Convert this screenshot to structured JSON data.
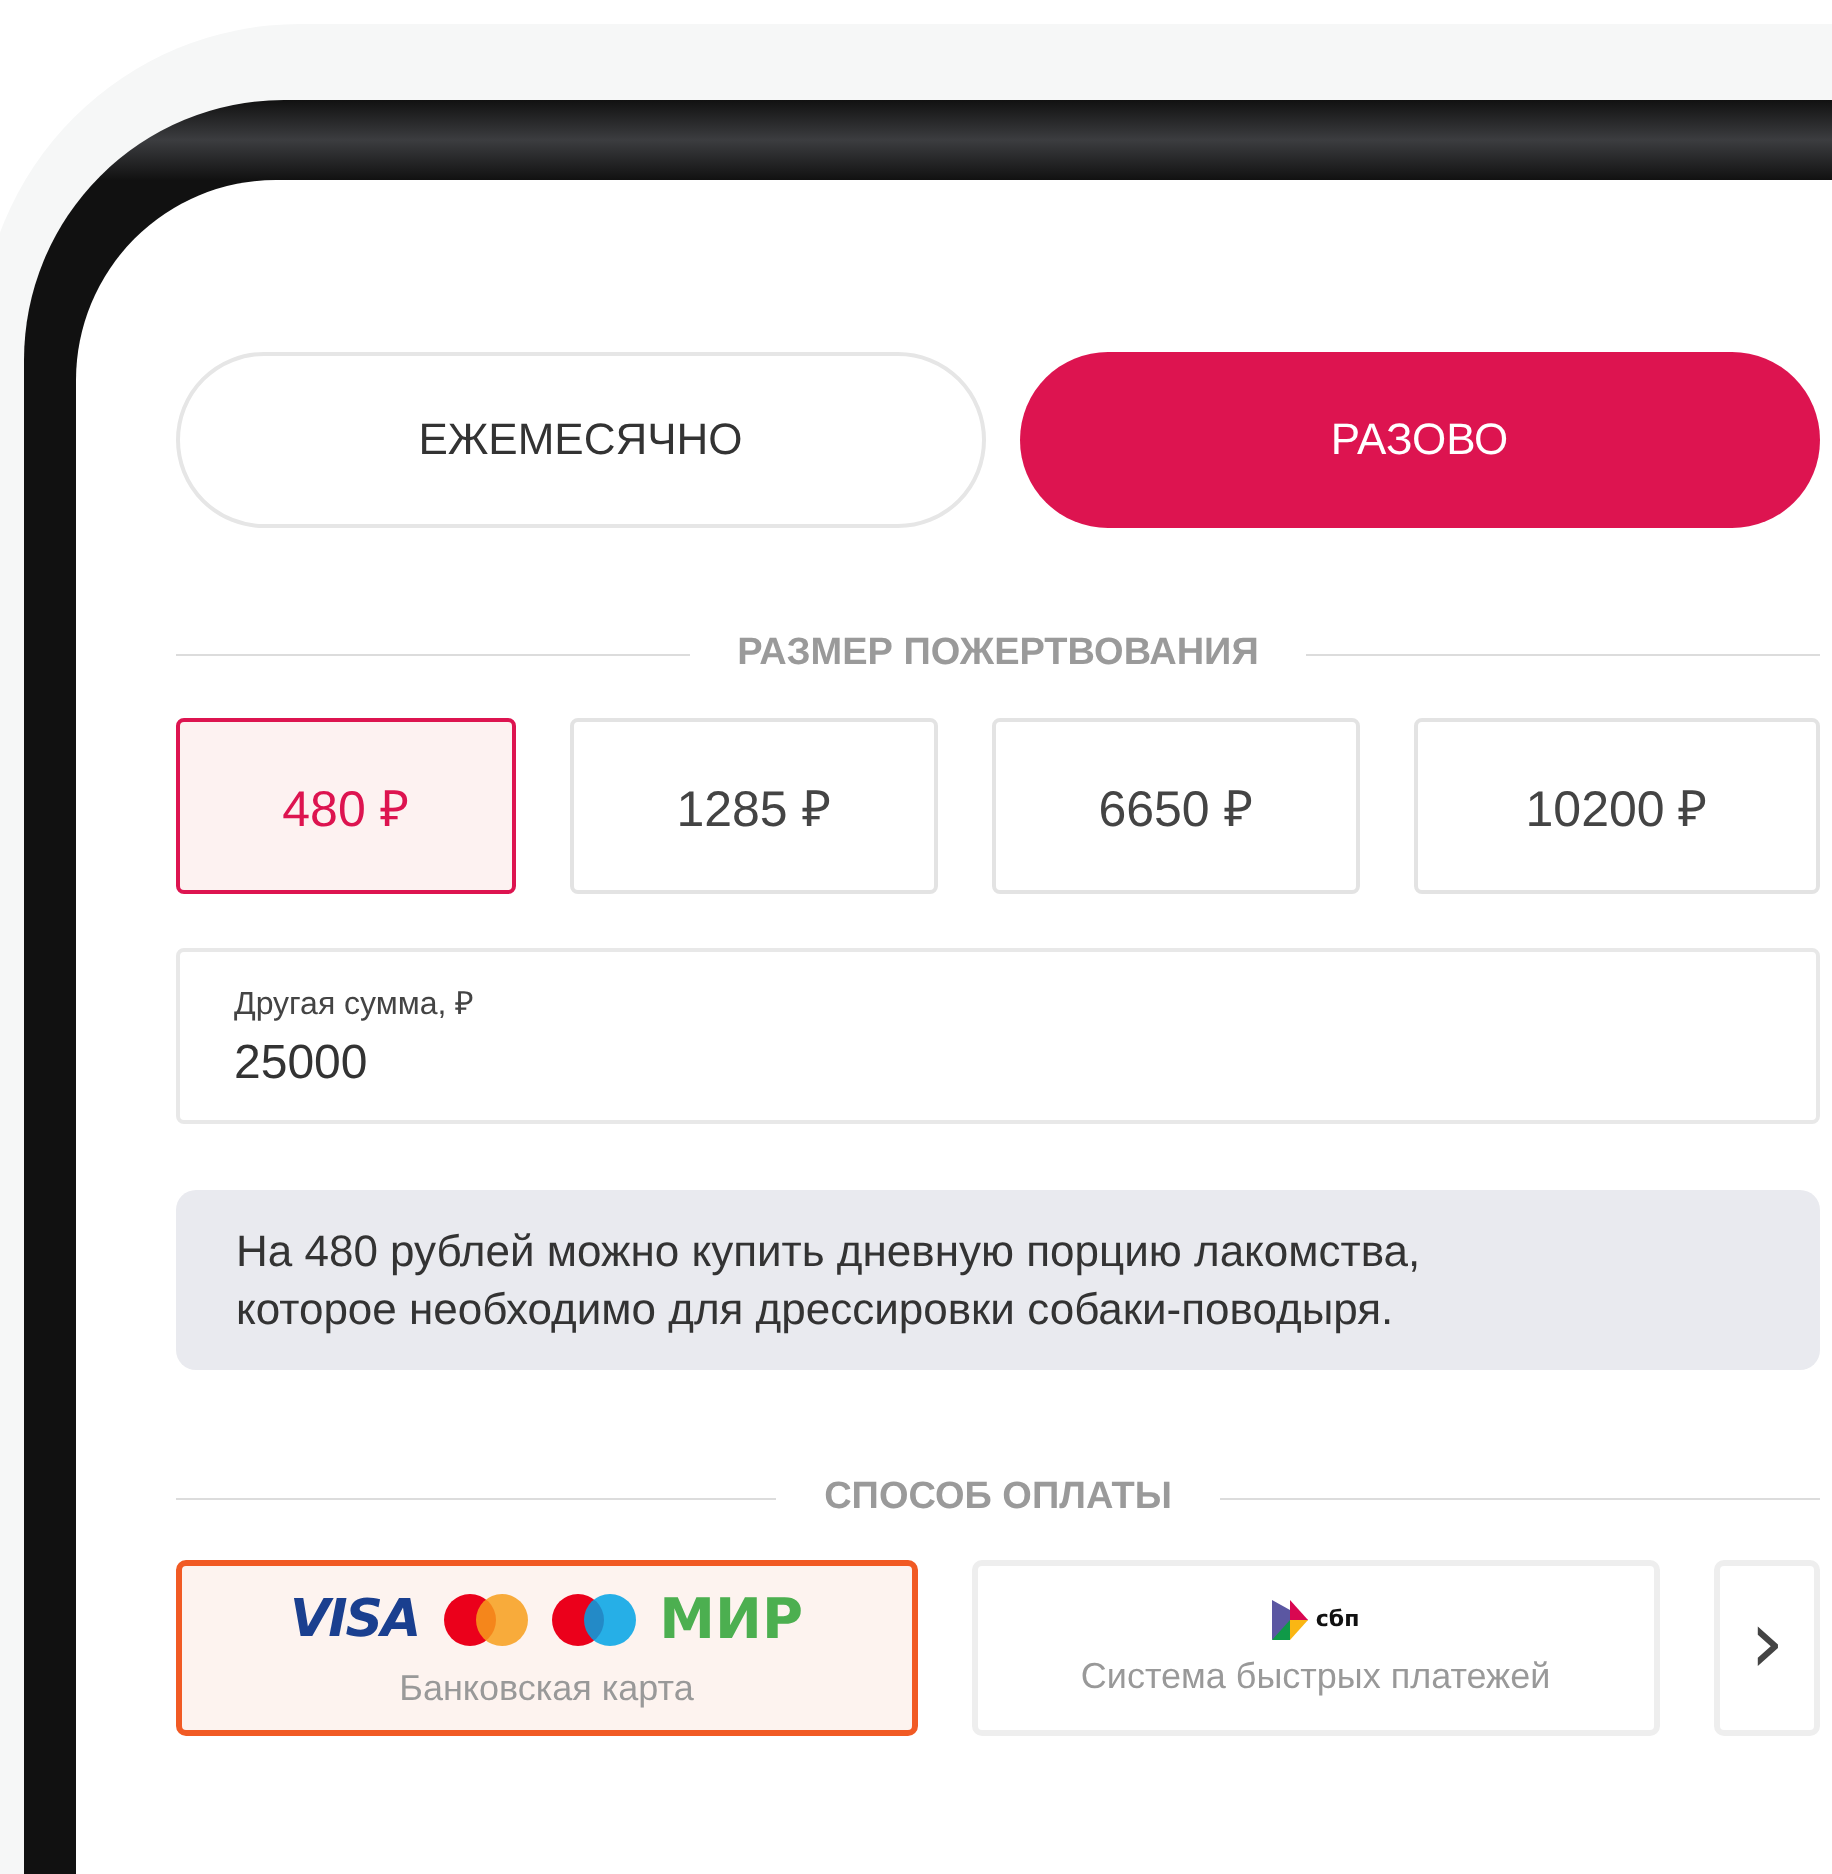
{
  "frequency_tabs": [
    {
      "label": "ЕЖЕМЕСЯЧНО",
      "selected": false
    },
    {
      "label": "РАЗОВО",
      "selected": true
    }
  ],
  "amount_section": {
    "title": "РАЗМЕР ПОЖЕРТВОВАНИЯ"
  },
  "amounts": [
    {
      "label": "480 ₽",
      "selected": true
    },
    {
      "label": "1285 ₽",
      "selected": false
    },
    {
      "label": "6650 ₽",
      "selected": false
    },
    {
      "label": "10200 ₽",
      "selected": false
    }
  ],
  "other_amount": {
    "label": "Другая сумма, ₽",
    "value": "25000"
  },
  "info": "На 480 рублей можно купить дневную порцию лакомства, которое необходимо для дрессировки собаки-поводыря.",
  "payment_section": {
    "title": "СПОСОБ ОПЛАТЫ"
  },
  "payment_methods": [
    {
      "kind": "card",
      "logos": [
        "VISA",
        "МИР"
      ],
      "label": "Банковская карта",
      "selected": true
    },
    {
      "kind": "sbp",
      "logos": [
        "сбп"
      ],
      "label": "Система быстрых платежей",
      "selected": false
    }
  ],
  "next_button": {
    "label": "›"
  }
}
